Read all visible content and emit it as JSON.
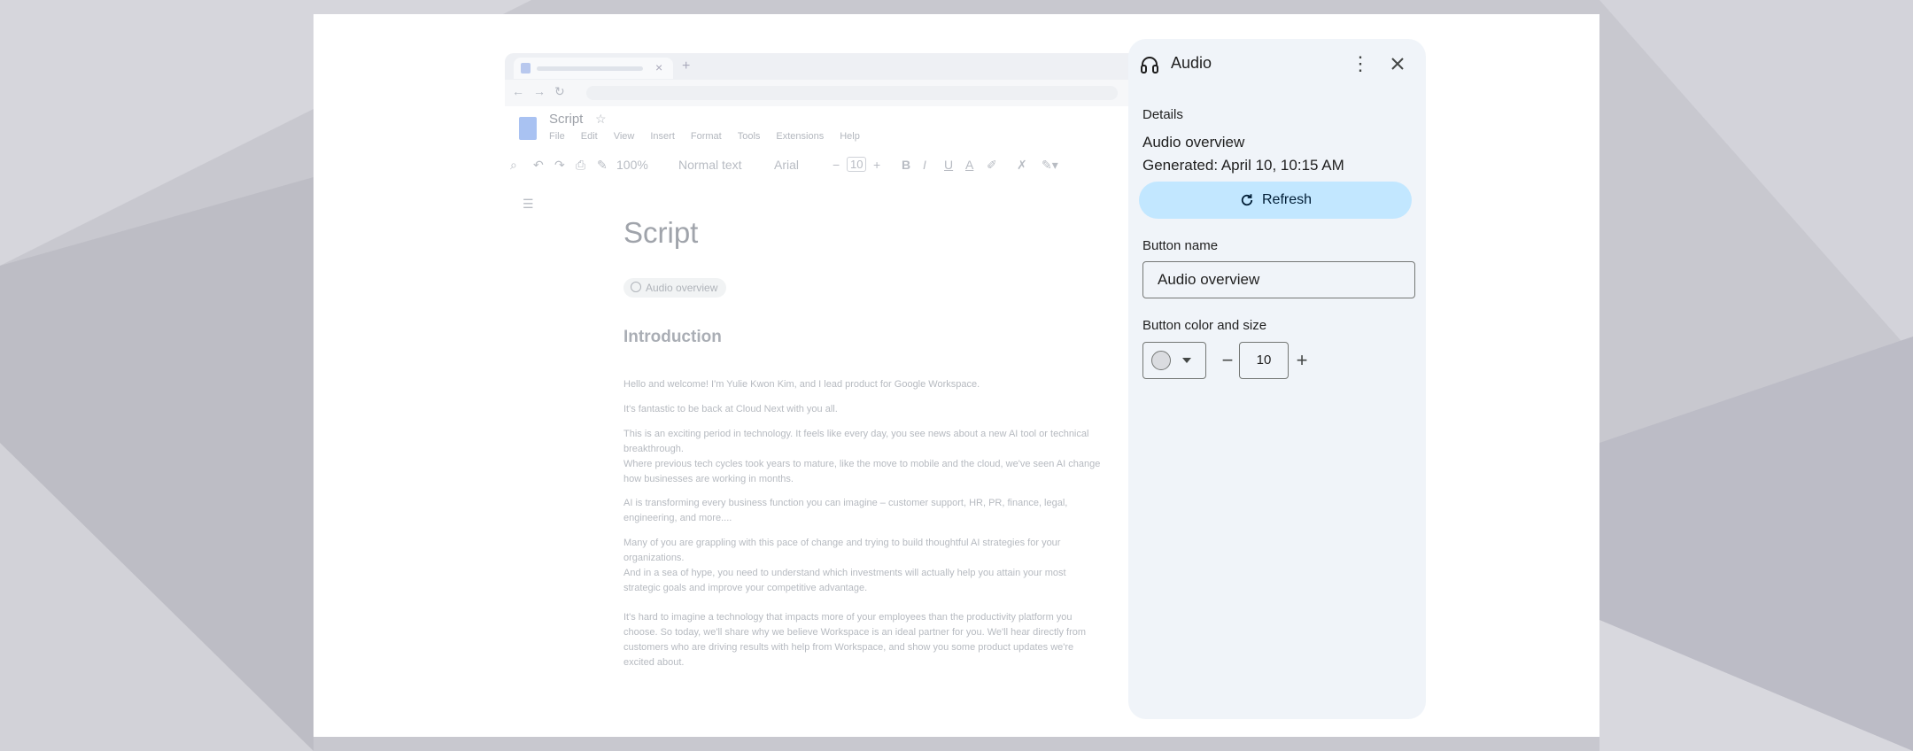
{
  "doc": {
    "title": "Script",
    "menu": [
      "File",
      "Edit",
      "View",
      "Insert",
      "Format",
      "Tools",
      "Extensions",
      "Help"
    ],
    "toolbar": {
      "zoom": "100%",
      "style": "Normal text",
      "font": "Arial",
      "font_size": "10"
    },
    "heading": "Script",
    "chip_label": "Audio overview",
    "section_heading": "Introduction",
    "paragraphs": [
      "Hello and welcome! I'm Yulie Kwon Kim, and I lead product for Google Workspace.",
      "It's fantastic to be back at Cloud Next with you all.",
      "This is an exciting period in technology. It feels like every day, you see news about a new AI tool or technical breakthrough.\nWhere previous tech cycles took years to mature, like the move to mobile and the cloud, we've seen AI change how businesses are working in months.",
      "AI is transforming every business function you can imagine – customer support, HR, PR, finance, legal, engineering, and more....",
      "Many of you are grappling with this pace of change and trying to build thoughtful AI strategies for your organizations.\nAnd in a sea of hype, you need to understand which investments will actually help you attain your most strategic goals and improve your competitive advantage.",
      "It's hard to imagine a technology that impacts more of your employees than the productivity platform you choose. So today, we'll share why we believe Workspace is an ideal partner for you. We'll hear directly from customers who are driving results with help from Workspace, and show you some product updates we're excited about."
    ]
  },
  "panel": {
    "title": "Audio",
    "header_icon": "headphones-icon",
    "details_label": "Details",
    "overview": "Audio overview",
    "generated": "Generated: April 10, 10:15 AM",
    "refresh_label": "Refresh",
    "button_name_label": "Button name",
    "button_name_value": "Audio overview",
    "color_size_label": "Button color and size",
    "size_value": "10",
    "accent": "#c2e7ff",
    "panel_bg": "#f0f4f9"
  }
}
